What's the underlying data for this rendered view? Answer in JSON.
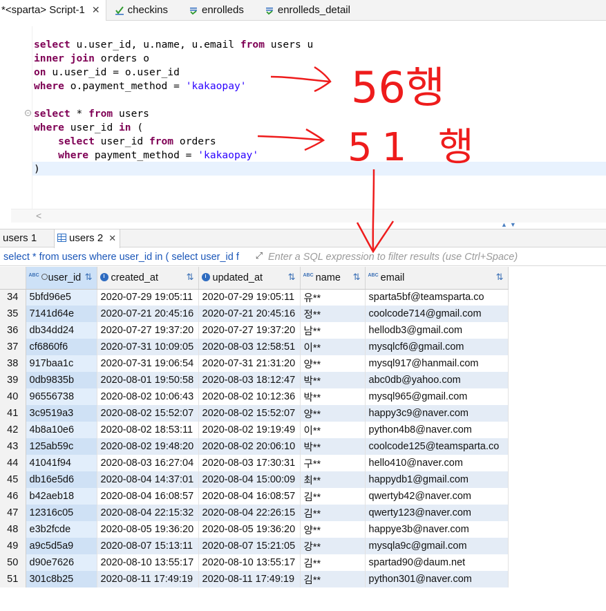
{
  "editor_tabs": [
    {
      "label": "*<sparta> Script-1",
      "active": true,
      "icon": "script-icon"
    },
    {
      "label": "checkins",
      "active": false,
      "icon": "table-icon"
    },
    {
      "label": "enrolleds",
      "active": false,
      "icon": "table-icon"
    },
    {
      "label": "enrolleds_detail",
      "active": false,
      "icon": "table-icon"
    }
  ],
  "editor": {
    "lines": [
      "select u.user_id, u.name, u.email from users u",
      "inner join orders o",
      "on u.user_id = o.user_id",
      "where o.payment_method = 'kakaopay'",
      "",
      "select * from users",
      "where user_id in (",
      "    select user_id from orders",
      "    where payment_method = 'kakaopay'",
      ")"
    ]
  },
  "annotations": {
    "first_query_rows": "56행",
    "second_query_rows": "51 행",
    "color": "#ee1c1c"
  },
  "result_tabs": [
    {
      "label": "users 1",
      "active": false
    },
    {
      "label": "users 2",
      "active": true
    }
  ],
  "filter_bar": {
    "query": "select * from users where user_id in ( select user_id f",
    "placeholder": "Enter a SQL expression to filter results (use Ctrl+Space)"
  },
  "grid": {
    "columns": [
      "user_id",
      "created_at",
      "updated_at",
      "name",
      "email"
    ],
    "column_types": [
      "text",
      "timestamp",
      "timestamp",
      "text",
      "text"
    ],
    "rows": [
      [
        "34",
        "5bfd96e5",
        "2020-07-29 19:05:11",
        "2020-07-29 19:05:11",
        "유**",
        "sparta5bf@teamsparta.co"
      ],
      [
        "35",
        "7141d64e",
        "2020-07-21 20:45:16",
        "2020-07-21 20:45:16",
        "정**",
        "coolcode714@gmail.com"
      ],
      [
        "36",
        "db34dd24",
        "2020-07-27 19:37:20",
        "2020-07-27 19:37:20",
        "남**",
        "hellodb3@gmail.com"
      ],
      [
        "37",
        "cf6860f6",
        "2020-07-31 10:09:05",
        "2020-08-03 12:58:51",
        "이**",
        "mysqlcf6@gmail.com"
      ],
      [
        "38",
        "917baa1c",
        "2020-07-31 19:06:54",
        "2020-07-31 21:31:20",
        "양**",
        "mysql917@hanmail.com"
      ],
      [
        "39",
        "0db9835b",
        "2020-08-01 19:50:58",
        "2020-08-03 18:12:47",
        "박**",
        "abc0db@yahoo.com"
      ],
      [
        "40",
        "96556738",
        "2020-08-02 10:06:43",
        "2020-08-02 10:12:36",
        "박**",
        "mysql965@gmail.com"
      ],
      [
        "41",
        "3c9519a3",
        "2020-08-02 15:52:07",
        "2020-08-02 15:52:07",
        "양**",
        "happy3c9@naver.com"
      ],
      [
        "42",
        "4b8a10e6",
        "2020-08-02 18:53:11",
        "2020-08-02 19:19:49",
        "이**",
        "python4b8@naver.com"
      ],
      [
        "43",
        "125ab59c",
        "2020-08-02 19:48:20",
        "2020-08-02 20:06:10",
        "박**",
        "coolcode125@teamsparta.co"
      ],
      [
        "44",
        "41041f94",
        "2020-08-03 16:27:04",
        "2020-08-03 17:30:31",
        "구**",
        "hello410@naver.com"
      ],
      [
        "45",
        "db16e5d6",
        "2020-08-04 14:37:01",
        "2020-08-04 15:00:09",
        "최**",
        "happydb1@gmail.com"
      ],
      [
        "46",
        "b42aeb18",
        "2020-08-04 16:08:57",
        "2020-08-04 16:08:57",
        "김**",
        "qwertyb42@naver.com"
      ],
      [
        "47",
        "12316c05",
        "2020-08-04 22:15:32",
        "2020-08-04 22:26:15",
        "김**",
        "qwerty123@naver.com"
      ],
      [
        "48",
        "e3b2fcde",
        "2020-08-05 19:36:20",
        "2020-08-05 19:36:20",
        "양**",
        "happye3b@naver.com"
      ],
      [
        "49",
        "a9c5d5a9",
        "2020-08-07 15:13:11",
        "2020-08-07 15:21:05",
        "강**",
        "mysqla9c@gmail.com"
      ],
      [
        "50",
        "d90e7626",
        "2020-08-10 13:55:17",
        "2020-08-10 13:55:17",
        "김**",
        "spartad90@daum.net"
      ],
      [
        "51",
        "301c8b25",
        "2020-08-11 17:49:19",
        "2020-08-11 17:49:19",
        "김**",
        "python301@naver.com"
      ]
    ]
  }
}
